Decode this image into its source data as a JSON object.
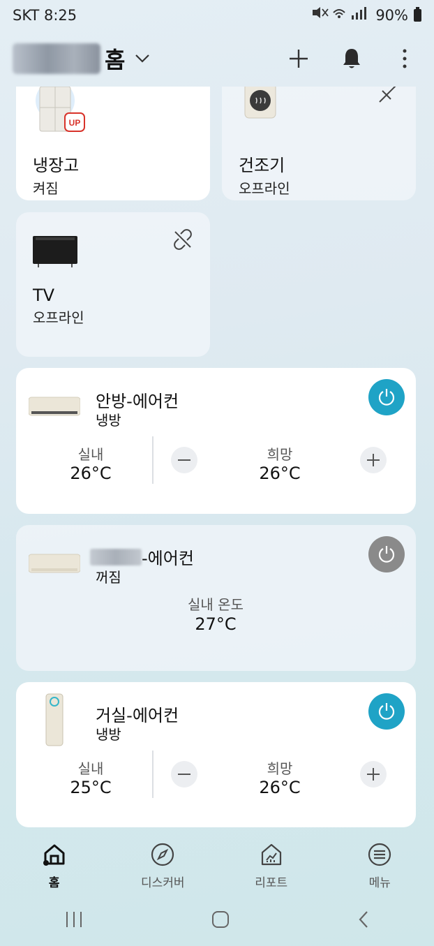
{
  "status_bar": {
    "carrier_time": "SKT 8:25",
    "battery": "90%"
  },
  "header": {
    "title": "홈"
  },
  "devices": [
    {
      "name": "냉장고",
      "status": "켜짐"
    },
    {
      "name": "건조기",
      "status": "오프라인"
    },
    {
      "name": "TV",
      "status": "오프라인"
    }
  ],
  "ac_units": [
    {
      "name": "안방-에어컨",
      "mode": "냉방",
      "indoor_label": "실내",
      "indoor_temp": "26°C",
      "target_label": "희망",
      "target_temp": "26°C",
      "power": "on"
    },
    {
      "name": "-에어컨",
      "mode": "꺼짐",
      "indoor_label": "실내 온도",
      "indoor_temp": "27°C",
      "power": "off"
    },
    {
      "name": "거실-에어컨",
      "mode": "냉방",
      "indoor_label": "실내",
      "indoor_temp": "25°C",
      "target_label": "희망",
      "target_temp": "26°C",
      "power": "on"
    }
  ],
  "bottom_nav": [
    {
      "label": "홈",
      "icon": "home-icon",
      "active": true
    },
    {
      "label": "디스커버",
      "icon": "compass-icon"
    },
    {
      "label": "리포트",
      "icon": "report-icon"
    },
    {
      "label": "메뉴",
      "icon": "menu-icon"
    }
  ],
  "colors": {
    "power_on": "#1fa3c6",
    "power_off": "#8a8a8a",
    "up_badge": "#d8332a"
  }
}
